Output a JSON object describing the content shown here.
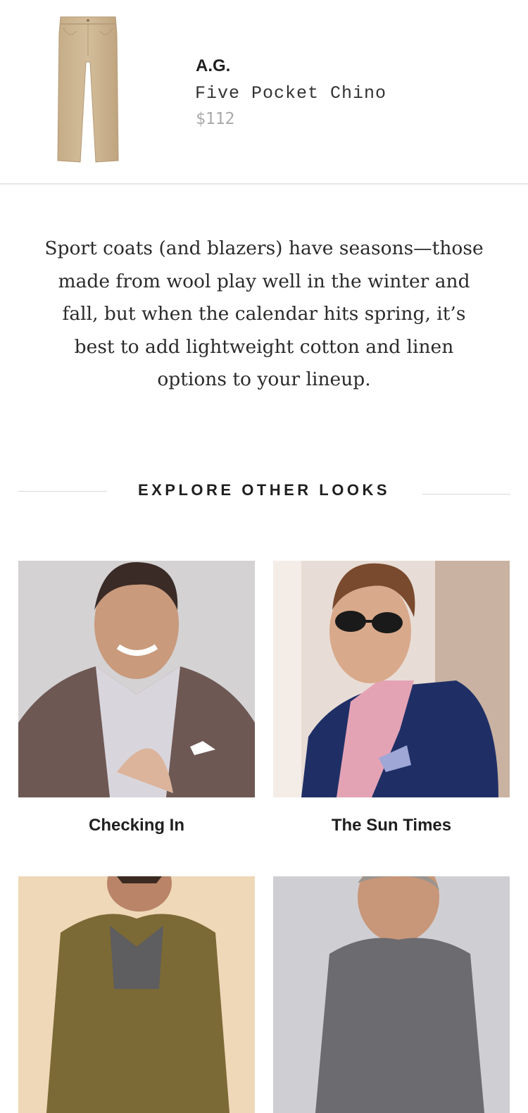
{
  "product": {
    "brand": "A.G.",
    "name": "Five Pocket Chino",
    "price": "$112",
    "image_icon": "khaki-pants-image",
    "color": "#cdb796"
  },
  "body_copy": "Sport coats (and blazers) have seasons—those made from wool play well in the winter and fall, but when the calendar hits spring, it’s best to add lightweight cotton and linen options to your lineup.",
  "section": {
    "title": "EXPLORE OTHER LOOKS"
  },
  "looks": [
    {
      "title": "Checking In",
      "image": "man-in-plaid-sport-coat-photo"
    },
    {
      "title": "The Sun Times",
      "image": "man-in-sunglasses-navy-blazer-photo"
    },
    {
      "title": "",
      "image": "man-in-olive-jacket-photo"
    },
    {
      "title": "",
      "image": "man-in-grey-coat-photo"
    }
  ]
}
